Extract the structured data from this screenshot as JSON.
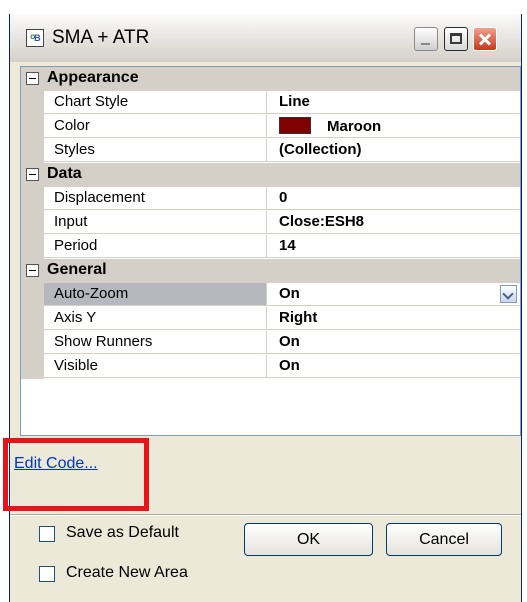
{
  "window": {
    "title": "SMA + ATR",
    "icon": "indicator-app-icon"
  },
  "properties": {
    "categories": [
      {
        "label": "Appearance",
        "items": [
          {
            "name": "Chart Style",
            "value": "Line"
          },
          {
            "name": "Color",
            "value": "Maroon",
            "color": "#800000"
          },
          {
            "name": "Styles",
            "value": "(Collection)"
          }
        ]
      },
      {
        "label": "Data",
        "items": [
          {
            "name": "Displacement",
            "value": "0"
          },
          {
            "name": "Input",
            "value": "Close:ESH8"
          },
          {
            "name": "Period",
            "value": "14"
          }
        ]
      },
      {
        "label": "General",
        "items": [
          {
            "name": "Auto-Zoom",
            "value": "On"
          },
          {
            "name": "Axis Y",
            "value": "Right"
          },
          {
            "name": "Show Runners",
            "value": "On"
          },
          {
            "name": "Visible",
            "value": "On"
          }
        ]
      }
    ]
  },
  "footer": {
    "edit_code_link": "Edit Code...",
    "save_default_label": "Save as Default",
    "create_area_label": "Create New Area",
    "ok_label": "OK",
    "cancel_label": "Cancel"
  },
  "colors": {
    "highlight_box": "#e8141a",
    "maroon": "#800000"
  }
}
